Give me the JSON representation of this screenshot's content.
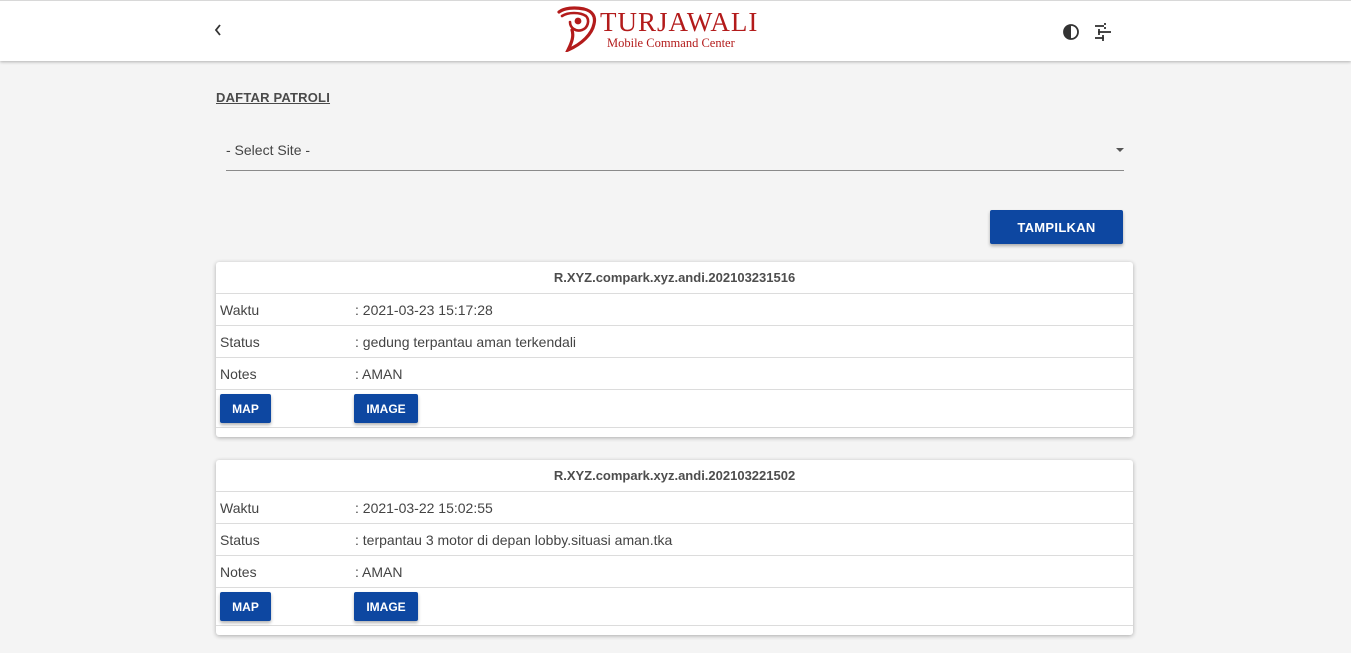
{
  "header": {
    "brand_name": "TURJAWALI",
    "brand_tagline": "Mobile Command Center",
    "icons": {
      "back": "chevron-left-icon",
      "contrast": "contrast-icon",
      "settings": "tune-icon"
    },
    "brand_color": "#b31b1b"
  },
  "page": {
    "title": "DAFTAR PATROLI",
    "site_select": {
      "value": "- Select Site -"
    },
    "show_button_label": "TAMPILKAN"
  },
  "labels": {
    "time": "Waktu",
    "status": "Status",
    "notes": "Notes",
    "map_button": "MAP",
    "image_button": "IMAGE"
  },
  "patrols": [
    {
      "id": "R.XYZ.compark.xyz.andi.202103231516",
      "time": ": 2021-03-23 15:17:28",
      "status": ": gedung terpantau aman terkendali",
      "notes": ": AMAN"
    },
    {
      "id": "R.XYZ.compark.xyz.andi.202103221502",
      "time": ": 2021-03-22 15:02:55",
      "status": ": terpantau 3 motor di depan lobby.situasi aman.tka",
      "notes": ": AMAN"
    }
  ],
  "colors": {
    "primary": "#0d47a1",
    "background": "#f4f4f4"
  }
}
